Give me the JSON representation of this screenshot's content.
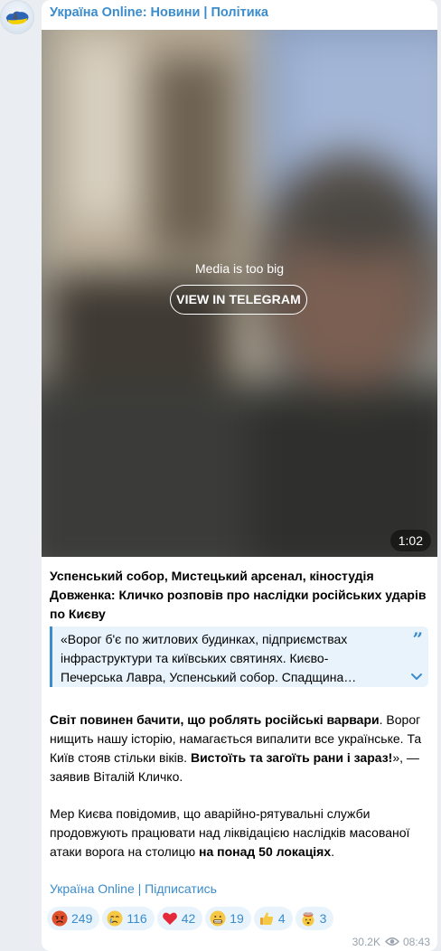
{
  "channel": {
    "name": "Україна Online: Новини | Політика",
    "subscribe_link": "Україна Online | Підписатись"
  },
  "media": {
    "message": "Media is too big",
    "view_button": "VIEW IN TELEGRAM",
    "duration": "1:02"
  },
  "post": {
    "title": "Успенський собор, Мистецький арсенал, кіностудія Довженка: Кличко розповів про наслідки російських ударів по Києву",
    "quote_lines": [
      "«Ворог б'є по житлових будинках, підприємствах",
      "інфраструктури та київських святинях.  Києво-",
      "Печерська Лавра, Успенський собор. Спадщина…"
    ],
    "p1": {
      "b1": "Світ повинен бачити, що роблять російські варвари",
      "t1": ". Ворог нищить нашу історію, намагається випалити все українське. Та Київ стояв стільки віків. ",
      "b2": "Вистоїть та загоїть рани і зараз!",
      "t2": "», — заявив Віталій Кличко."
    },
    "p2": {
      "t1": "Мер Києва повідомив, що аварійно-рятувальні служби продовжують працювати над ліквідацією наслідків масованої атаки ворога на столицю ",
      "b1": "на понад 50 локаціях",
      "t2": "."
    }
  },
  "reactions": [
    {
      "icon": "angry-face-icon",
      "count": "249"
    },
    {
      "icon": "crying-face-icon",
      "count": "116"
    },
    {
      "icon": "red-heart-icon",
      "count": "42"
    },
    {
      "icon": "grimacing-face-icon",
      "count": "19"
    },
    {
      "icon": "thumbs-up-icon",
      "count": "4"
    },
    {
      "icon": "exploding-head-icon",
      "count": "3"
    }
  ],
  "meta": {
    "views": "30.2K",
    "time": "08:43"
  },
  "colors": {
    "accent": "#3a8ccc",
    "quote_bg": "#e8f3fc",
    "background": "#eaeef2",
    "meta": "#98a3ad"
  }
}
